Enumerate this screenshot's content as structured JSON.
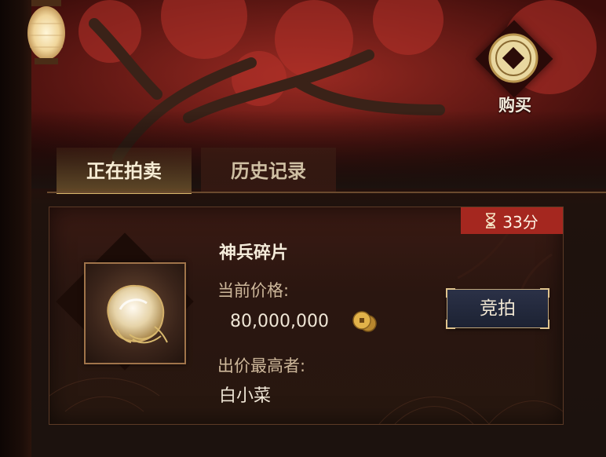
{
  "header": {
    "buy_label": "购买",
    "buy_icon": "coin-icon"
  },
  "tabs": [
    {
      "label": "正在拍卖",
      "active": true
    },
    {
      "label": "历史记录",
      "active": false
    }
  ],
  "auction_item": {
    "name": "神兵碎片",
    "timer": "33分",
    "timer_icon": "hourglass-icon",
    "price_label": "当前价格:",
    "price_value": "80,000,000",
    "currency_icon": "copper-coin-icon",
    "bidder_label": "出价最高者:",
    "bidder_name": "白小菜",
    "bid_button_label": "竞拍"
  },
  "colors": {
    "timer_badge": "#a5271f",
    "accent_gold": "#d8b76b",
    "bid_button": "#2b3147"
  }
}
